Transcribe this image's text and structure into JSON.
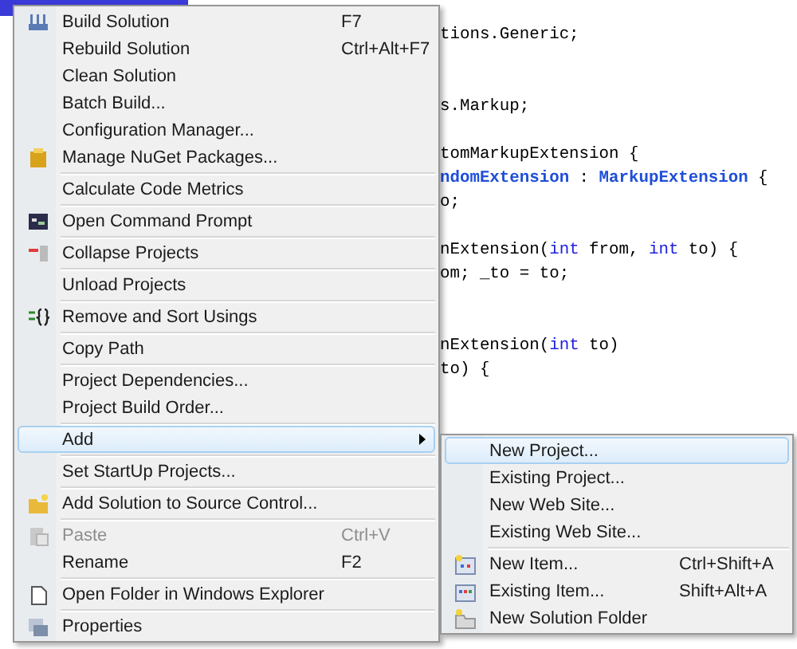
{
  "editor": {
    "lines": [
      {
        "kind": "code",
        "segments": [
          {
            "kind": "plain",
            "text": "tions.Generic;"
          }
        ]
      },
      {
        "kind": "blank"
      },
      {
        "kind": "blank"
      },
      {
        "kind": "code",
        "segments": [
          {
            "kind": "plain",
            "text": "s.Markup;"
          }
        ]
      },
      {
        "kind": "blank"
      },
      {
        "kind": "code",
        "segments": [
          {
            "kind": "plain",
            "text": "tomMarkupExtension {"
          }
        ]
      },
      {
        "kind": "code",
        "segments": [
          {
            "kind": "type",
            "text": "ndomExtension"
          },
          {
            "kind": "plain",
            "text": " : "
          },
          {
            "kind": "type",
            "text": "MarkupExtension"
          },
          {
            "kind": "plain",
            "text": " {"
          }
        ]
      },
      {
        "kind": "code",
        "segments": [
          {
            "kind": "plain",
            "text": "o;"
          }
        ]
      },
      {
        "kind": "blank"
      },
      {
        "kind": "code",
        "segments": [
          {
            "kind": "plain",
            "text": "nExtension("
          },
          {
            "kind": "keyword",
            "text": "int"
          },
          {
            "kind": "plain",
            "text": " from, "
          },
          {
            "kind": "keyword",
            "text": "int"
          },
          {
            "kind": "plain",
            "text": " to) {"
          }
        ]
      },
      {
        "kind": "code",
        "segments": [
          {
            "kind": "plain",
            "text": "om; _to = to;"
          }
        ]
      },
      {
        "kind": "blank"
      },
      {
        "kind": "blank"
      },
      {
        "kind": "code",
        "segments": [
          {
            "kind": "plain",
            "text": "nExtension("
          },
          {
            "kind": "keyword",
            "text": "int"
          },
          {
            "kind": "plain",
            "text": " to)"
          }
        ]
      },
      {
        "kind": "code",
        "segments": [
          {
            "kind": "plain",
            "text": "to) {"
          }
        ]
      }
    ]
  },
  "context_menu": {
    "items": [
      {
        "kind": "item",
        "label": "Build Solution",
        "shortcut": "F7",
        "disabled": false,
        "selected": false
      },
      {
        "kind": "item",
        "label": "Rebuild Solution",
        "shortcut": "Ctrl+Alt+F7",
        "disabled": false,
        "selected": false
      },
      {
        "kind": "item",
        "label": "Clean Solution",
        "disabled": false,
        "selected": false
      },
      {
        "kind": "item",
        "label": "Batch Build...",
        "disabled": false,
        "selected": false
      },
      {
        "kind": "item",
        "label": "Configuration Manager...",
        "disabled": false,
        "selected": false
      },
      {
        "kind": "item",
        "label": "Manage NuGet Packages...",
        "disabled": false,
        "selected": false
      },
      {
        "kind": "separator"
      },
      {
        "kind": "item",
        "label": "Calculate Code Metrics",
        "disabled": false,
        "selected": false
      },
      {
        "kind": "separator"
      },
      {
        "kind": "item",
        "label": "Open Command Prompt",
        "disabled": false,
        "selected": false
      },
      {
        "kind": "separator"
      },
      {
        "kind": "item",
        "label": "Collapse Projects",
        "disabled": false,
        "selected": false
      },
      {
        "kind": "separator"
      },
      {
        "kind": "item",
        "label": "Unload Projects",
        "disabled": false,
        "selected": false
      },
      {
        "kind": "separator"
      },
      {
        "kind": "item",
        "label": "Remove and Sort Usings",
        "disabled": false,
        "selected": false
      },
      {
        "kind": "separator"
      },
      {
        "kind": "item",
        "label": "Copy Path",
        "disabled": false,
        "selected": false
      },
      {
        "kind": "separator"
      },
      {
        "kind": "item",
        "label": "Project Dependencies...",
        "disabled": false,
        "selected": false
      },
      {
        "kind": "item",
        "label": "Project Build Order...",
        "disabled": false,
        "selected": false
      },
      {
        "kind": "separator"
      },
      {
        "kind": "submenu",
        "label": "Add",
        "disabled": false,
        "selected": true
      },
      {
        "kind": "separator"
      },
      {
        "kind": "item",
        "label": "Set StartUp Projects...",
        "disabled": false,
        "selected": false
      },
      {
        "kind": "separator"
      },
      {
        "kind": "item",
        "label": "Add Solution to Source Control...",
        "disabled": false,
        "selected": false
      },
      {
        "kind": "separator"
      },
      {
        "kind": "item",
        "label": "Paste",
        "shortcut": "Ctrl+V",
        "disabled": true,
        "selected": false
      },
      {
        "kind": "item",
        "label": "Rename",
        "shortcut": "F2",
        "disabled": false,
        "selected": false
      },
      {
        "kind": "separator"
      },
      {
        "kind": "item",
        "label": "Open Folder in Windows Explorer",
        "disabled": false,
        "selected": false
      },
      {
        "kind": "separator"
      },
      {
        "kind": "item",
        "label": "Properties",
        "disabled": false,
        "selected": false
      }
    ]
  },
  "submenu": {
    "items": [
      {
        "kind": "item",
        "label": "New Project...",
        "disabled": false,
        "selected": true
      },
      {
        "kind": "item",
        "label": "Existing Project...",
        "disabled": false,
        "selected": false
      },
      {
        "kind": "item",
        "label": "New Web Site...",
        "disabled": false,
        "selected": false
      },
      {
        "kind": "item",
        "label": "Existing Web Site...",
        "disabled": false,
        "selected": false
      },
      {
        "kind": "separator"
      },
      {
        "kind": "item",
        "label": "New Item...",
        "shortcut": "Ctrl+Shift+A",
        "disabled": false,
        "selected": false
      },
      {
        "kind": "item",
        "label": "Existing Item...",
        "shortcut": "Shift+Alt+A",
        "disabled": false,
        "selected": false
      },
      {
        "kind": "item",
        "label": "New Solution Folder",
        "disabled": false,
        "selected": false
      }
    ]
  }
}
